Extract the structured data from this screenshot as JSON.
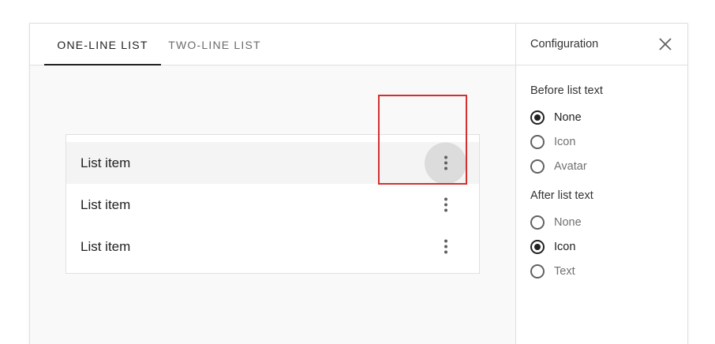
{
  "tabs": [
    {
      "label": "ONE-LINE LIST",
      "active": true
    },
    {
      "label": "TWO-LINE LIST",
      "active": false
    }
  ],
  "list": {
    "items": [
      {
        "label": "List item",
        "hovered": true,
        "action_icon": "more-vert-icon"
      },
      {
        "label": "List item",
        "hovered": false,
        "action_icon": "more-vert-icon"
      },
      {
        "label": "List item",
        "hovered": false,
        "action_icon": "more-vert-icon"
      }
    ]
  },
  "config": {
    "title": "Configuration",
    "close_icon": "close-icon",
    "before": {
      "title": "Before list text",
      "options": [
        {
          "label": "None",
          "checked": true
        },
        {
          "label": "Icon",
          "checked": false
        },
        {
          "label": "Avatar",
          "checked": false
        }
      ]
    },
    "after": {
      "title": "After list text",
      "options": [
        {
          "label": "None",
          "checked": false
        },
        {
          "label": "Icon",
          "checked": true
        },
        {
          "label": "Text",
          "checked": false
        }
      ]
    }
  },
  "colors": {
    "highlight": "#d32f2f",
    "text": "#212121",
    "hover_bg": "#f4f4f4"
  }
}
